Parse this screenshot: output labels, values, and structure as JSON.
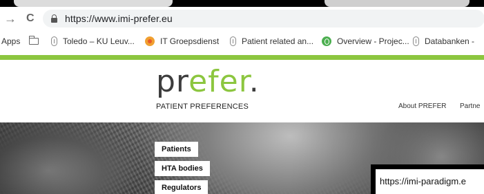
{
  "browser": {
    "url": "https://www.imi-prefer.eu",
    "back_symbol": "←",
    "forward_symbol": "→",
    "reload_symbol": "C",
    "icons": {
      "reload": "reload-icon",
      "lock": "lock-icon",
      "forward": "forward-arrow-icon"
    }
  },
  "bookmarks": [
    {
      "label": "Apps",
      "icon": "apps-icon"
    },
    {
      "label": "",
      "icon": "folder-icon"
    },
    {
      "label": "Toledo – KU Leuv...",
      "icon": "ku-leuven-icon"
    },
    {
      "label": "IT Groepsdienst",
      "icon": "it-groepsdienst-icon"
    },
    {
      "label": "Patient related an...",
      "icon": "ku-leuven-icon"
    },
    {
      "label": "Overview - Projec...",
      "icon": "overview-icon"
    },
    {
      "label": "Databanken - ",
      "icon": "ku-leuven-icon"
    }
  ],
  "site": {
    "logo_pr": "pr",
    "logo_efer": "efer",
    "logo_dot": ".",
    "tagline": "PATIENT PREFERENCES",
    "nav": [
      "About PREFER",
      "Partne"
    ]
  },
  "hero_menu": [
    "Patients",
    "HTA bodies",
    "Regulators"
  ],
  "status_bar": {
    "text": "https://imi-paradigm.e"
  },
  "colors": {
    "brand_green": "#8cc63f",
    "logo_gray": "#3d3d3d"
  }
}
